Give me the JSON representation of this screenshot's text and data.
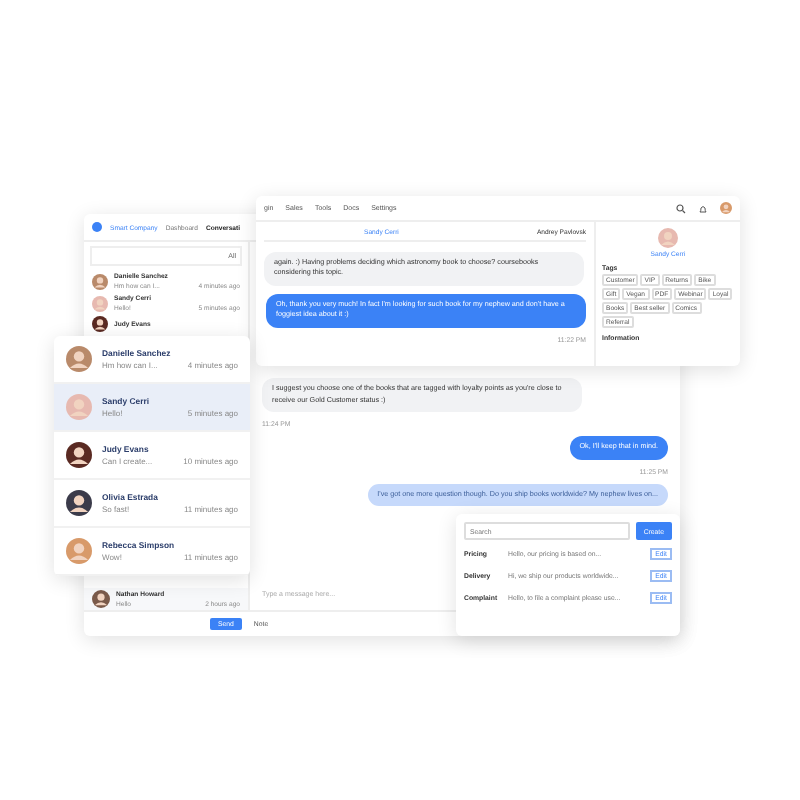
{
  "back_window": {
    "company": "Smart Company",
    "nav": [
      {
        "label": "Dashboard",
        "selected": false
      },
      {
        "label": "Conversati",
        "selected": true
      }
    ],
    "filter": "All",
    "contacts": [
      {
        "name": "Danielle Sanchez",
        "preview": "Hm how can I...",
        "time": "4 minutes ago"
      },
      {
        "name": "Sandy Cerri",
        "preview": "Hello!",
        "time": "5 minutes ago"
      },
      {
        "name": "Judy Evans"
      }
    ],
    "last_contact": {
      "name": "Nathan Howard",
      "preview": "Hello",
      "time": "2 hours ago"
    },
    "messages": [
      {
        "kind": "incoming",
        "text": "I suggest you choose one of the books that are tagged with loyalty points as you're close to receive our Gold Customer status :)",
        "time": "11:24 PM"
      },
      {
        "kind": "outgoing",
        "text": "Ok, I'll keep that in mind.",
        "time": "11:25 PM"
      },
      {
        "kind": "pending",
        "text": "I've got one more question though. Do you ship books worldwide? My nephew lives on..."
      }
    ],
    "composer": {
      "placeholder": "Type a message here..."
    },
    "send": "Send",
    "note": "Note"
  },
  "front_window": {
    "menu": [
      "gin",
      "Sales",
      "Tools",
      "Docs",
      "Settings"
    ],
    "contact": "Sandy Cerri",
    "agent": "Andrey Pavlovsk",
    "messages": [
      {
        "kind": "incoming",
        "text": "again. :) Having problems deciding which astronomy book to choose? coursebooks considering this topic."
      },
      {
        "kind": "outgoing",
        "text": "Oh, thank you very much! In fact I'm looking for such book for my nephew and don't have a foggiest idea about it :)",
        "time": "11:22 PM"
      }
    ],
    "profile_name": "Sandy Cerri",
    "tags_title": "Tags",
    "tags": [
      "Customer",
      "VIP",
      "Returns",
      "Bike",
      "Gift",
      "Vegan",
      "PDF",
      "Webinar",
      "Loyal",
      "Books",
      "Best seller",
      "Comics",
      "Referral"
    ],
    "information": "Information"
  },
  "contact_card": [
    {
      "name": "Danielle Sanchez",
      "preview": "Hm how can I...",
      "time": "4 minutes ago",
      "selected": false
    },
    {
      "name": "Sandy Cerri",
      "preview": "Hello!",
      "time": "5 minutes ago",
      "selected": true
    },
    {
      "name": "Judy Evans",
      "preview": "Can I create...",
      "time": "10 minutes ago",
      "selected": false
    },
    {
      "name": "Olivia Estrada",
      "preview": "So fast!",
      "time": "11 minutes ago",
      "selected": false
    },
    {
      "name": "Rebecca Simpson",
      "preview": "Wow!",
      "time": "11 minutes ago",
      "selected": false
    }
  ],
  "canned": {
    "placeholder": "Search",
    "create": "Create",
    "rows": [
      {
        "title": "Pricing",
        "text": "Hello, our pricing is based on...",
        "action": "Edit"
      },
      {
        "title": "Delivery",
        "text": "Hi, we ship our products worldwide...",
        "action": "Edit"
      },
      {
        "title": "Complaint",
        "text": "Hello, to file a complaint please use...",
        "action": "Edit"
      }
    ]
  }
}
